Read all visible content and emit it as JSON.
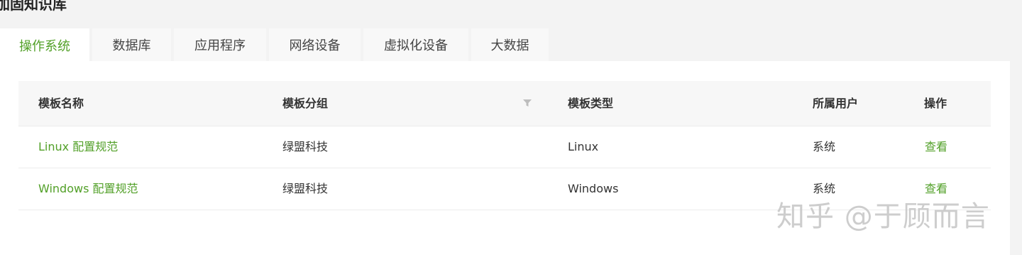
{
  "page": {
    "title": "加固知识库"
  },
  "tabs": [
    {
      "label": "操作系统",
      "active": true
    },
    {
      "label": "数据库",
      "active": false
    },
    {
      "label": "应用程序",
      "active": false
    },
    {
      "label": "网络设备",
      "active": false
    },
    {
      "label": "虚拟化设备",
      "active": false
    },
    {
      "label": "大数据",
      "active": false
    }
  ],
  "table": {
    "columns": {
      "name": "模板名称",
      "group": "模板分组",
      "type": "模板类型",
      "owner": "所属用户",
      "action": "操作"
    },
    "rows": [
      {
        "name": "Linux 配置规范",
        "group": "绿盟科技",
        "type": "Linux",
        "owner": "系统",
        "action": "查看"
      },
      {
        "name": "Windows 配置规范",
        "group": "绿盟科技",
        "type": "Windows",
        "owner": "系统",
        "action": "查看"
      }
    ]
  },
  "watermark": {
    "text": "知乎 @于顾而言"
  },
  "colors": {
    "accent": "#52a028",
    "header_bg": "#f7f7f7",
    "page_bg": "#f3f3f3"
  },
  "icons": {
    "filter": "filter-icon"
  }
}
